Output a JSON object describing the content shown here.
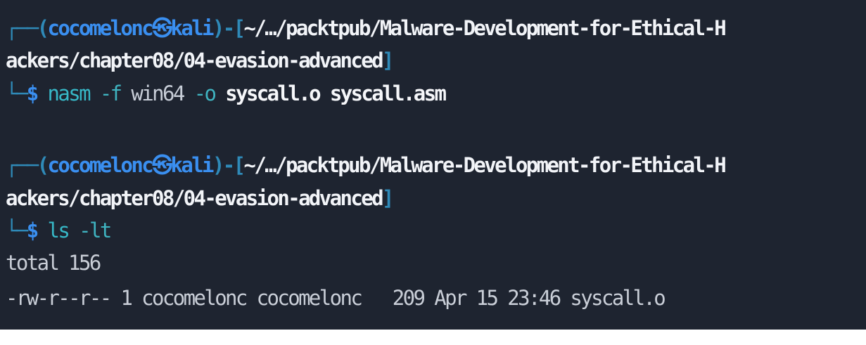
{
  "colors": {
    "background": "#1e2430",
    "prompt_frame": "#2f8ab8",
    "prompt_user": "#3a8ff0",
    "path": "#f2f4f8",
    "command": "#37b8c7",
    "output": "#c9ced7"
  },
  "prompt": {
    "top_open": "┌──(",
    "user": "cocomelonc",
    "at_icon": "㉿",
    "host": "kali",
    "close_open_bracket": ")-[",
    "path_part1": "~/…/packtpub/Malware-Development-for-Ethical-H",
    "path_part2": "ackers/chapter08/04-evasion-advanced",
    "close_bracket": "]",
    "bottom": "└─",
    "dollar": "$"
  },
  "commands": [
    {
      "program": "nasm",
      "tokens": [
        {
          "text": "-f",
          "style": "flag"
        },
        {
          "text": "win64",
          "style": "argdim"
        },
        {
          "text": "-o",
          "style": "flag"
        },
        {
          "text": "syscall.o",
          "style": "argb"
        },
        {
          "text": "syscall.asm",
          "style": "argb"
        }
      ]
    },
    {
      "program": "ls",
      "tokens": [
        {
          "text": "-lt",
          "style": "flag"
        }
      ]
    }
  ],
  "output": [
    "total 156",
    "-rw-r--r-- 1 cocomelonc cocomelonc   209 Apr 15 23:46 syscall.o"
  ]
}
